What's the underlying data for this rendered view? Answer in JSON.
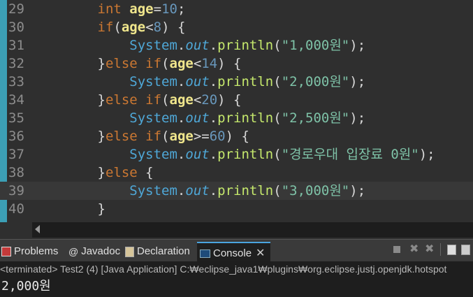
{
  "editor": {
    "lines": [
      {
        "num": "29",
        "tokens": [
          [
            "",
            "        "
          ],
          [
            "kw",
            "int "
          ],
          [
            "var",
            "age"
          ],
          [
            "op",
            "="
          ],
          [
            "num",
            "10"
          ],
          [
            "op",
            ";"
          ]
        ]
      },
      {
        "num": "30",
        "tokens": [
          [
            "",
            "        "
          ],
          [
            "kw",
            "if"
          ],
          [
            "op",
            "("
          ],
          [
            "var",
            "age"
          ],
          [
            "op",
            "<"
          ],
          [
            "num",
            "8"
          ],
          [
            "op",
            ") {"
          ]
        ]
      },
      {
        "num": "31",
        "tokens": [
          [
            "",
            "            "
          ],
          [
            "sys",
            "System"
          ],
          [
            "op",
            "."
          ],
          [
            "out",
            "out"
          ],
          [
            "op",
            "."
          ],
          [
            "meth",
            "println"
          ],
          [
            "op",
            "("
          ],
          [
            "str",
            "\"1,000원\""
          ],
          [
            "op",
            ");"
          ]
        ]
      },
      {
        "num": "32",
        "tokens": [
          [
            "",
            "        "
          ],
          [
            "op",
            "}"
          ],
          [
            "kw",
            "else if"
          ],
          [
            "op",
            "("
          ],
          [
            "var",
            "age"
          ],
          [
            "op",
            "<"
          ],
          [
            "num",
            "14"
          ],
          [
            "op",
            ") {"
          ]
        ]
      },
      {
        "num": "33",
        "tokens": [
          [
            "",
            "            "
          ],
          [
            "sys",
            "System"
          ],
          [
            "op",
            "."
          ],
          [
            "out",
            "out"
          ],
          [
            "op",
            "."
          ],
          [
            "meth",
            "println"
          ],
          [
            "op",
            "("
          ],
          [
            "str",
            "\"2,000원\""
          ],
          [
            "op",
            ");"
          ]
        ]
      },
      {
        "num": "34",
        "tokens": [
          [
            "",
            "        "
          ],
          [
            "op",
            "}"
          ],
          [
            "kw",
            "else if"
          ],
          [
            "op",
            "("
          ],
          [
            "var",
            "age"
          ],
          [
            "op",
            "<"
          ],
          [
            "num",
            "20"
          ],
          [
            "op",
            ") {"
          ]
        ]
      },
      {
        "num": "35",
        "tokens": [
          [
            "",
            "            "
          ],
          [
            "sys",
            "System"
          ],
          [
            "op",
            "."
          ],
          [
            "out",
            "out"
          ],
          [
            "op",
            "."
          ],
          [
            "meth",
            "println"
          ],
          [
            "op",
            "("
          ],
          [
            "str",
            "\"2,500원\""
          ],
          [
            "op",
            ");"
          ]
        ]
      },
      {
        "num": "36",
        "tokens": [
          [
            "",
            "        "
          ],
          [
            "op",
            "}"
          ],
          [
            "kw",
            "else if"
          ],
          [
            "op",
            "("
          ],
          [
            "var",
            "age"
          ],
          [
            "op",
            ">="
          ],
          [
            "num",
            "60"
          ],
          [
            "op",
            ") {"
          ]
        ]
      },
      {
        "num": "37",
        "tokens": [
          [
            "",
            "            "
          ],
          [
            "sys",
            "System"
          ],
          [
            "op",
            "."
          ],
          [
            "out",
            "out"
          ],
          [
            "op",
            "."
          ],
          [
            "meth",
            "println"
          ],
          [
            "op",
            "("
          ],
          [
            "str",
            "\"경로우대 입장료 0원\""
          ],
          [
            "op",
            ");"
          ]
        ]
      },
      {
        "num": "38",
        "tokens": [
          [
            "",
            "        "
          ],
          [
            "op",
            "}"
          ],
          [
            "kw",
            "else"
          ],
          [
            "op",
            " {"
          ]
        ]
      },
      {
        "num": "39",
        "tokens": [
          [
            "",
            "            "
          ],
          [
            "sys",
            "System"
          ],
          [
            "op",
            "."
          ],
          [
            "out",
            "out"
          ],
          [
            "op",
            "."
          ],
          [
            "meth",
            "println"
          ],
          [
            "op",
            "("
          ],
          [
            "str",
            "\"3,000원\""
          ],
          [
            "op",
            ");"
          ]
        ]
      },
      {
        "num": "40",
        "tokens": [
          [
            "",
            "        "
          ],
          [
            "op",
            "}"
          ]
        ]
      }
    ],
    "current_line": "39"
  },
  "tabs": {
    "problems": "Problems",
    "javadoc": "Javadoc",
    "javadoc_icon": "@",
    "declaration": "Declaration",
    "console": "Console"
  },
  "console": {
    "header": "<terminated> Test2 (4) [Java Application] C:₩eclipse_java1₩plugins₩org.eclipse.justj.openjdk.hotspot",
    "output": "2,000원"
  }
}
